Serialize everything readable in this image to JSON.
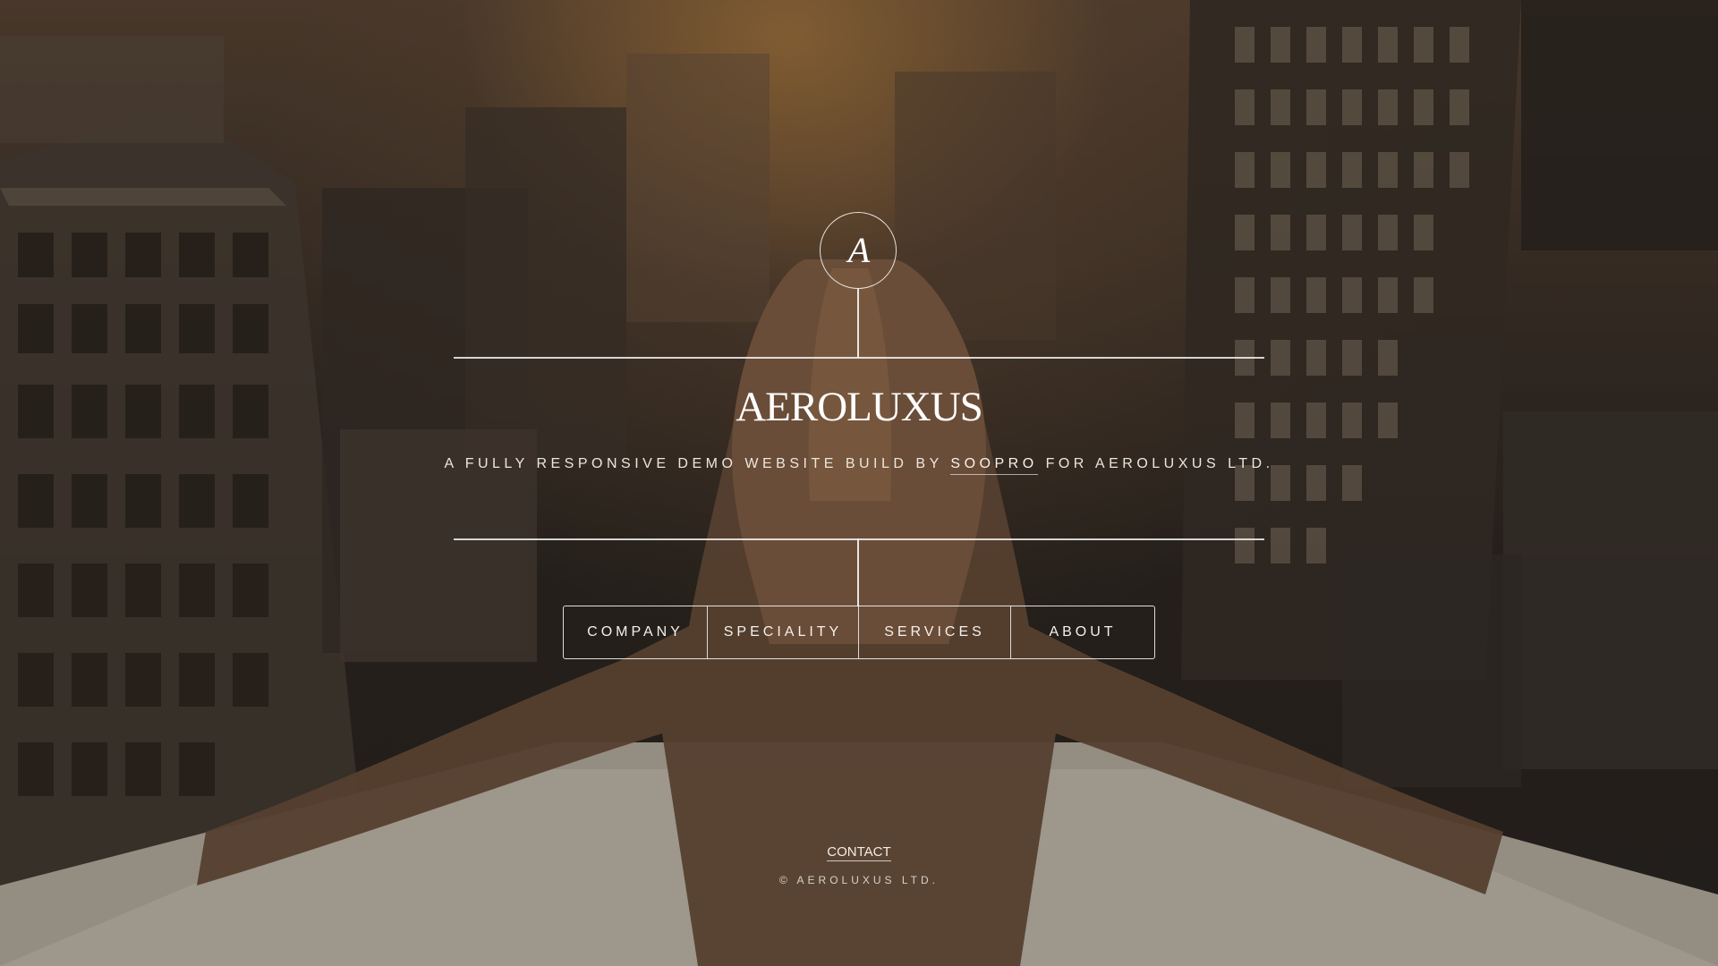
{
  "brand": {
    "logo_mark": "A",
    "name": "AEROLUXUS",
    "tagline_prefix": "A FULLY RESPONSIVE DEMO WEBSITE BUILD BY ",
    "tagline_link": "SOOPRO",
    "tagline_suffix": " FOR AEROLUXUS LTD."
  },
  "nav": {
    "items": [
      {
        "label": "COMPANY"
      },
      {
        "label": "SPECIALITY"
      },
      {
        "label": "SERVICES"
      },
      {
        "label": "ABOUT"
      }
    ]
  },
  "footer": {
    "contact_label": "CONTACT",
    "copyright": "© AEROLUXUS LTD."
  },
  "colors": {
    "text": "#ffffff",
    "line": "#ffffff",
    "background_warm": "#5a4535",
    "background_dark": "#2a2522"
  },
  "background_image": "woman-overlooking-city-photo"
}
